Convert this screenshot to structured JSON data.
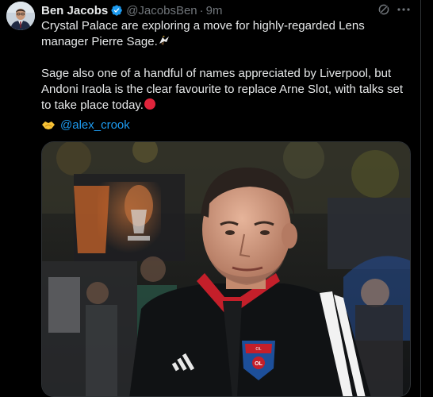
{
  "tweet": {
    "author_name": "Ben Jacobs",
    "handle": "@JacobsBen",
    "separator": "·",
    "time": "9m",
    "line1": "Crystal Palace are exploring a move for highly-regarded Lens manager Pierre Sage.",
    "line2": "Sage also one of a handful of names appreciated by Liverpool, but Andoni Iraola is the clear favourite to replace Arne Slot, with talks set to take place today.",
    "mention": "@alex_crook",
    "badge_text": "OLYMPIQUE LYONNAIS"
  },
  "colors": {
    "background": "#000000",
    "text": "#e7e9ea",
    "muted": "#71767b",
    "link": "#1d9bf0",
    "verified": "#1d9bf0"
  },
  "icons": [
    "verified-badge-icon",
    "grok-icon",
    "more-icon",
    "eagle-emoji",
    "red-circle-emoji",
    "handshake-emoji"
  ]
}
